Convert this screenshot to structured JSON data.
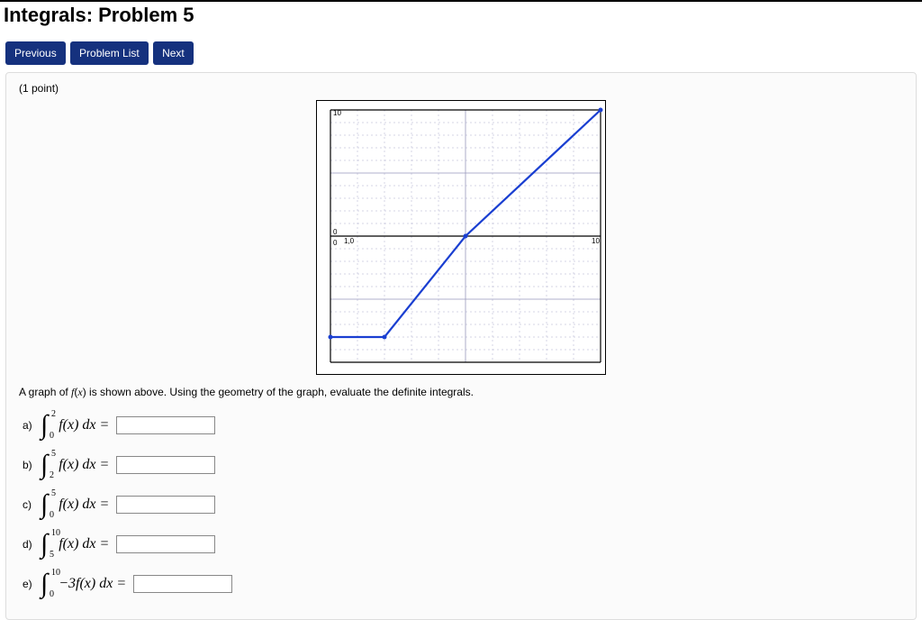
{
  "title": "Integrals: Problem 5",
  "nav": {
    "prev": "Previous",
    "list": "Problem List",
    "next": "Next"
  },
  "points_text": "(1 point)",
  "prompt": "A graph of f(x) is shown above. Using the geometry of the graph, evaluate the definite integrals.",
  "parts": {
    "a": {
      "label": "a)",
      "lower": "0",
      "upper": "2",
      "integrand": "f(x) dx ="
    },
    "b": {
      "label": "b)",
      "lower": "2",
      "upper": "5",
      "integrand": "f(x) dx ="
    },
    "c": {
      "label": "c)",
      "lower": "0",
      "upper": "5",
      "integrand": "f(x) dx ="
    },
    "d": {
      "label": "d)",
      "lower": "5",
      "upper": "10",
      "integrand": "f(x) dx ="
    },
    "e": {
      "label": "e)",
      "lower": "0",
      "upper": "10",
      "integrand": "−3f(x) dx ="
    }
  },
  "chart_data": {
    "type": "line",
    "title": "",
    "xlabel": "",
    "ylabel": "",
    "xlim": [
      0,
      10
    ],
    "ylim": [
      -10,
      10
    ],
    "x_ticks": [
      0,
      5,
      10
    ],
    "y_ticks_labeled": [
      0,
      10
    ],
    "axis_label_at_origin": "1,0",
    "series": [
      {
        "name": "f(x)",
        "x": [
          0,
          2,
          5,
          10
        ],
        "y": [
          -8,
          -8,
          0,
          10
        ],
        "color": "#1a3fd1"
      }
    ],
    "grid": true
  }
}
